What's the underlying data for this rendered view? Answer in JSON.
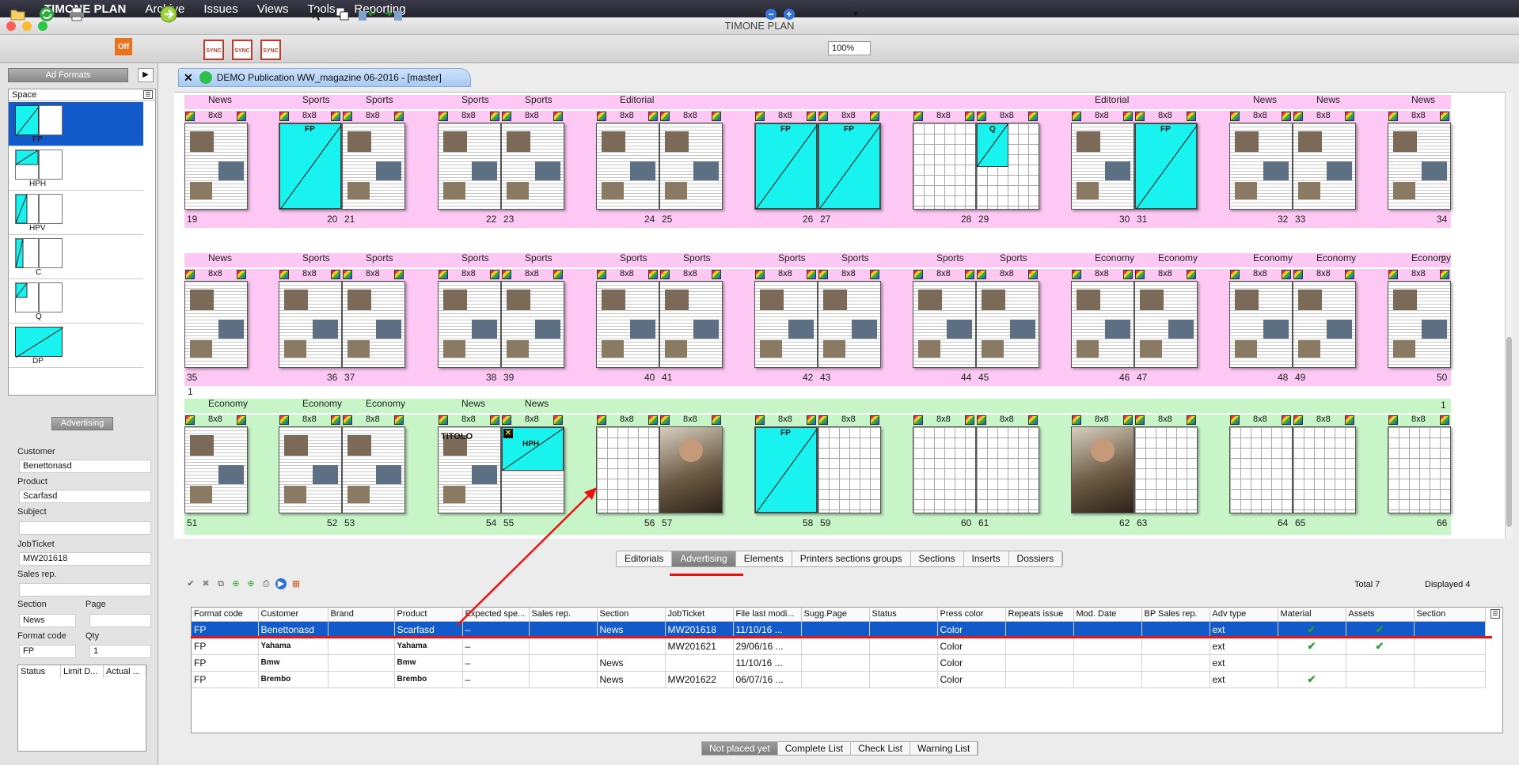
{
  "menu": {
    "app": "TIMONE PLAN",
    "items": [
      "Archive",
      "Issues",
      "Views",
      "Tools",
      "Reporting"
    ]
  },
  "window": {
    "title": "TIMONE PLAN"
  },
  "toolbar": {
    "zoom": "100%",
    "off_label": "Off",
    "sync_label": "SYNC"
  },
  "left": {
    "header": "Ad Formats",
    "space_header": "Space",
    "formats": [
      "FP",
      "HPH",
      "HPV",
      "C",
      "Q",
      "DP"
    ]
  },
  "advertising": {
    "header": "Advertising",
    "customer_label": "Customer",
    "customer": "Benettonasd",
    "product_label": "Product",
    "product": "Scarfasd",
    "subject_label": "Subject",
    "subject": "",
    "jobticket_label": "JobTicket",
    "jobticket": "MW201618",
    "salesrep_label": "Sales rep.",
    "salesrep": "",
    "section_label": "Section",
    "section": "News",
    "page_label": "Page",
    "page": "",
    "formatcode_label": "Format code",
    "formatcode": "FP",
    "qty_label": "Qty",
    "qty": "1",
    "status_cols": [
      "Status",
      "Limit D...",
      "Actual ..."
    ]
  },
  "doc": {
    "title": "DEMO Publication WW_magazine 06-2016 - [master]"
  },
  "rows": [
    {
      "bg": "#fdc8f3",
      "sections": [
        "News",
        "Sports",
        "Sports",
        "Sports",
        "Sports",
        "Editorial",
        "",
        "",
        "",
        "",
        "",
        "Editorial",
        "",
        "News",
        "News",
        "News"
      ],
      "pages": [
        "19",
        "20",
        "21",
        "22",
        "23",
        "24",
        "25",
        "26",
        "27",
        "28",
        "29",
        "30",
        "31",
        "32",
        "33",
        "34"
      ],
      "rightnum": ""
    },
    {
      "bg": "#fdc8f3",
      "sections": [
        "News",
        "Sports",
        "Sports",
        "Sports",
        "Sports",
        "Sports",
        "Sports",
        "Sports",
        "Sports",
        "Sports",
        "Sports",
        "Economy",
        "Economy",
        "Economy",
        "Economy",
        "Economy"
      ],
      "pages": [
        "35",
        "36",
        "37",
        "38",
        "39",
        "40",
        "41",
        "42",
        "43",
        "44",
        "45",
        "46",
        "47",
        "48",
        "49",
        "50"
      ],
      "rightnum": "2"
    },
    {
      "bg": "#c8f5c8",
      "sections": [
        "Economy",
        "Economy",
        "Economy",
        "News",
        "News",
        "",
        "",
        "",
        "",
        "",
        "",
        "",
        "",
        "",
        "",
        ""
      ],
      "pages": [
        "51",
        "52",
        "53",
        "54",
        "55",
        "56",
        "57",
        "58",
        "59",
        "60",
        "61",
        "62",
        "63",
        "64",
        "65",
        "66"
      ],
      "rightnum": "1"
    }
  ],
  "tile": {
    "label": "8x8",
    "fp": "FP",
    "q": "Q",
    "hph": "HPH",
    "titolo": "TITOLO"
  },
  "tabs": [
    "Editorials",
    "Advertising",
    "Elements",
    "Printers sections groups",
    "Sections",
    "Inserts",
    "Dossiers"
  ],
  "active_tab": "Advertising",
  "totals": {
    "total": "Total  7",
    "displayed": "Displayed  4"
  },
  "table": {
    "columns": [
      "Format code",
      "Customer",
      "Brand",
      "Product",
      "Expected spe...",
      "Sales rep.",
      "Section",
      "JobTicket",
      "File last modi...",
      "Sugg.Page",
      "Status",
      "Press color",
      "Repeats issue",
      "Mod. Date",
      "BP Sales rep.",
      "Adv type",
      "Material",
      "Assets",
      "Section"
    ],
    "rows": [
      {
        "format": "FP",
        "customer": "Benettonasd",
        "brand": "",
        "product": "Scarfasd",
        "expected": "–",
        "sales": "",
        "section": "News",
        "job": "MW201618",
        "file": "11/10/16 ...",
        "sugg": "",
        "status": "",
        "color": "Color",
        "repeats": "",
        "mod": "",
        "bp": "",
        "adv": "ext",
        "material": "✔",
        "assets": "✔",
        "section2": ""
      },
      {
        "format": "FP",
        "customer": "Yahama",
        "brand": "",
        "product": "Yahama",
        "expected": "–",
        "sales": "",
        "section": "",
        "job": "MW201621",
        "file": "29/06/16 ...",
        "sugg": "",
        "status": "",
        "color": "Color",
        "repeats": "",
        "mod": "",
        "bp": "",
        "adv": "ext",
        "material": "✔",
        "assets": "✔",
        "section2": ""
      },
      {
        "format": "FP",
        "customer": "Bmw",
        "brand": "",
        "product": "Bmw",
        "expected": "–",
        "sales": "",
        "section": "News",
        "job": "",
        "file": "11/10/16 ...",
        "sugg": "",
        "status": "",
        "color": "Color",
        "repeats": "",
        "mod": "",
        "bp": "",
        "adv": "ext",
        "material": "",
        "assets": "",
        "section2": ""
      },
      {
        "format": "FP",
        "customer": "Brembo",
        "brand": "",
        "product": "Brembo",
        "expected": "–",
        "sales": "",
        "section": "News",
        "job": "MW201622",
        "file": "06/07/16 ...",
        "sugg": "",
        "status": "",
        "color": "Color",
        "repeats": "",
        "mod": "",
        "bp": "",
        "adv": "ext",
        "material": "✔",
        "assets": "",
        "section2": ""
      }
    ]
  },
  "list_tabs": [
    "Not placed yet",
    "Complete List",
    "Check List",
    "Warning List"
  ],
  "colors": {
    "selection": "#1259c9",
    "cyan": "#19f3ef",
    "pink": "#fdc8f3",
    "green": "#c8f5c8",
    "arrow": "#e11"
  }
}
